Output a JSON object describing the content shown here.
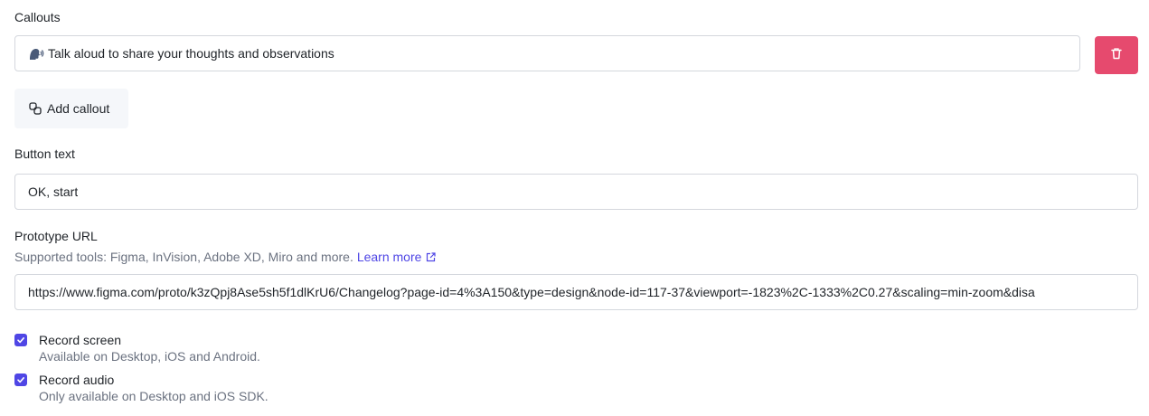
{
  "callouts": {
    "label": "Callouts",
    "items": [
      {
        "text": "Talk aloud to share your thoughts and observations",
        "emoji_icon": "speaking-head-icon"
      }
    ],
    "delete_icon": "trash-icon",
    "add_label": "Add callout",
    "add_icon": "link-chain-icon"
  },
  "button_text": {
    "label": "Button text",
    "value": "OK, start"
  },
  "prototype": {
    "label": "Prototype URL",
    "help": "Supported tools: Figma, InVision, Adobe XD, Miro and more.",
    "learn_more": "Learn more",
    "learn_more_icon": "external-link-icon",
    "value": "https://www.figma.com/proto/k3zQpj8Ase5sh5f1dlKrU6/Changelog?page-id=4%3A150&type=design&node-id=117-37&viewport=-1823%2C-1333%2C0.27&scaling=min-zoom&disa"
  },
  "options": [
    {
      "title": "Record screen",
      "sub": "Available on Desktop, iOS and Android.",
      "checked": true
    },
    {
      "title": "Record audio",
      "sub": "Only available on Desktop and iOS SDK.",
      "checked": true
    }
  ],
  "colors": {
    "danger": "#e64a6e",
    "accent": "#4f46e5",
    "muted": "#6b7280",
    "border": "#d4d7dd"
  }
}
